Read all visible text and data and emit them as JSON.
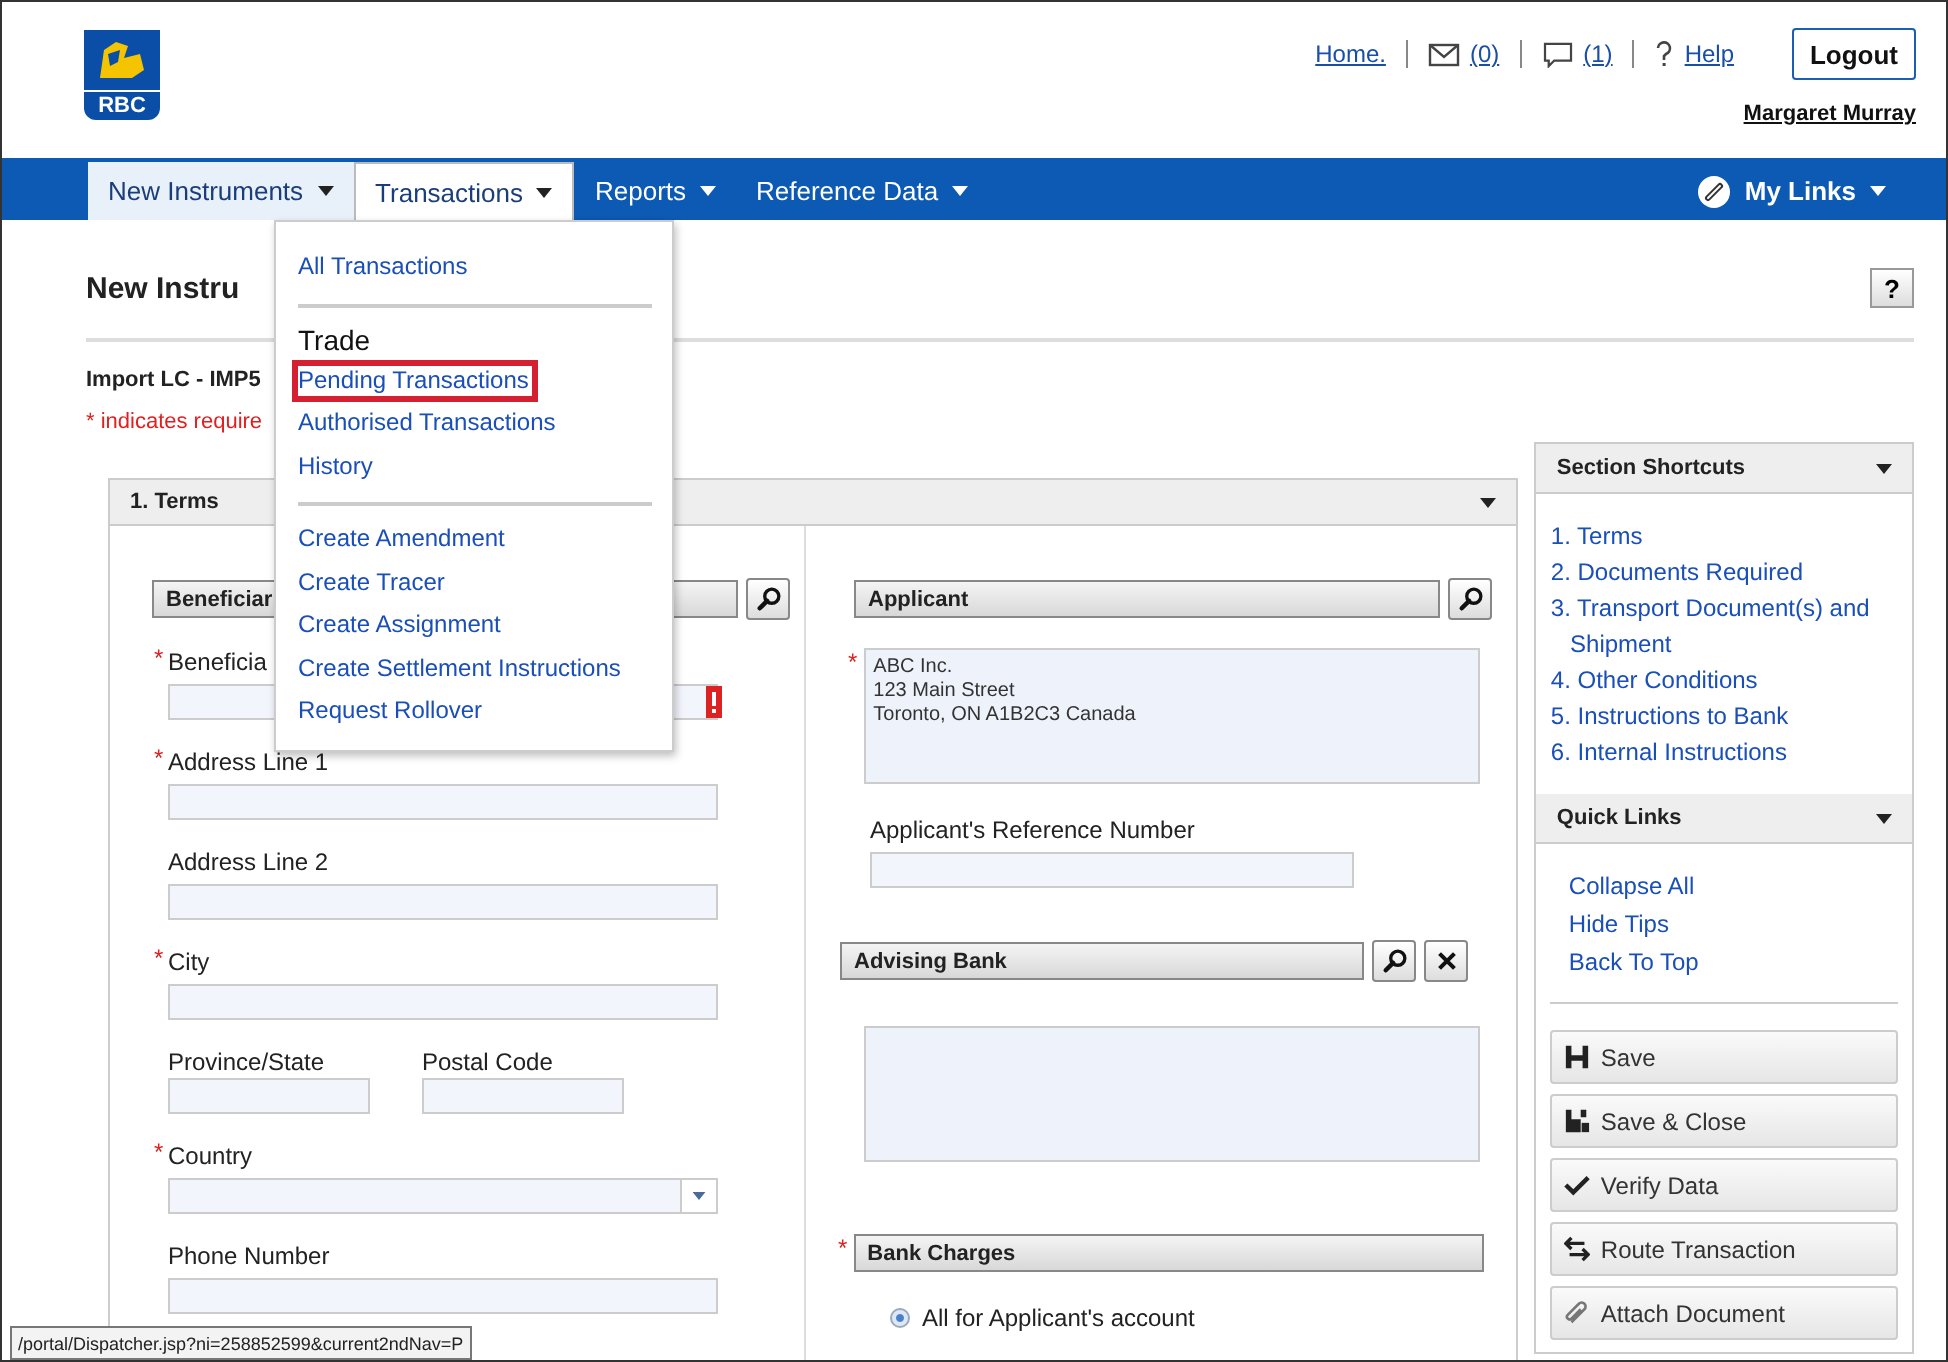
{
  "header": {
    "logo_text": "RBC",
    "links": [
      {
        "kind": "home",
        "label": "Home."
      },
      {
        "kind": "mail",
        "label": "(0)"
      },
      {
        "kind": "chat",
        "label": "(1)"
      },
      {
        "kind": "help",
        "label": "Help"
      }
    ],
    "logout": "Logout",
    "user": "Margaret Murray"
  },
  "nav": {
    "items": [
      {
        "label": "New Instruments",
        "current": true,
        "open": false
      },
      {
        "label": "Transactions",
        "current": false,
        "open": true
      },
      {
        "label": "Reports",
        "current": false,
        "open": false
      },
      {
        "label": "Reference Data",
        "current": false,
        "open": false
      }
    ],
    "my_links": "My Links"
  },
  "page": {
    "title": "New Instru",
    "help": "?",
    "subtitle": "Import LC - IMP5",
    "required_note": "* indicates require"
  },
  "terms": {
    "title": "1. Terms",
    "left": [
      {
        "kind": "lookup",
        "label": "Beneficiar",
        "clearable": false
      },
      {
        "kind": "text",
        "label": "Beneficia",
        "required": true,
        "error": true
      },
      {
        "kind": "text",
        "label": "Address Line 1",
        "required": true,
        "error": false
      },
      {
        "kind": "text",
        "label": "Address Line 2",
        "required": false,
        "error": false
      },
      {
        "kind": "text",
        "label": "City",
        "required": true,
        "error": false
      },
      {
        "kind": "pair",
        "fields": [
          {
            "label": "Province/State"
          },
          {
            "label": "Postal Code"
          }
        ]
      },
      {
        "kind": "select",
        "label": "Country",
        "required": true,
        "error": false
      },
      {
        "kind": "text",
        "label": "Phone Number",
        "required": false,
        "error": false
      }
    ],
    "right": [
      {
        "kind": "lookup",
        "label": "Applicant",
        "clearable": false
      },
      {
        "kind": "textarea",
        "required": true,
        "lines": [
          "ABC Inc.",
          "123 Main Street",
          "Toronto, ON A1B2C3 Canada"
        ]
      },
      {
        "kind": "text",
        "label": "Applicant's Reference Number",
        "required": false,
        "error": false
      },
      {
        "kind": "lookup",
        "label": "Advising Bank",
        "clearable": true
      },
      {
        "kind": "textarea",
        "required": false
      },
      {
        "kind": "bar",
        "label": "Bank Charges",
        "required": true
      },
      {
        "kind": "radio",
        "label": "All for Applicant's account",
        "selected": true
      }
    ]
  },
  "sidebar": {
    "shortcuts": {
      "title": "Section Shortcuts",
      "items": [
        "1. Terms",
        "2. Documents Required",
        "3. Transport Document(s) and Shipment",
        "4. Other Conditions",
        "5. Instructions to Bank",
        "6. Internal Instructions"
      ]
    },
    "quick_links": {
      "title": "Quick Links",
      "items": [
        "Collapse All",
        "Hide Tips",
        "Back To Top"
      ]
    },
    "actions": [
      {
        "kind": "save",
        "label": "Save"
      },
      {
        "kind": "save_close",
        "label": "Save & Close"
      },
      {
        "kind": "verify",
        "label": "Verify Data"
      },
      {
        "kind": "route",
        "label": "Route Transaction"
      },
      {
        "kind": "attach",
        "label": "Attach Document"
      }
    ]
  },
  "menu": {
    "groups": [
      {
        "items": [
          {
            "label": "All Transactions",
            "highlighted": false
          }
        ]
      },
      {
        "heading": "Trade",
        "items": [
          {
            "label": "Pending Transactions",
            "highlighted": true
          },
          {
            "label": "Authorised Transactions",
            "highlighted": false
          },
          {
            "label": "History",
            "highlighted": false
          }
        ]
      },
      {
        "items": [
          {
            "label": "Create Amendment",
            "highlighted": false
          },
          {
            "label": "Create Tracer",
            "highlighted": false
          },
          {
            "label": "Create Assignment",
            "highlighted": false
          },
          {
            "label": "Create Settlement Instructions",
            "highlighted": false
          },
          {
            "label": "Request Rollover",
            "highlighted": false
          }
        ]
      }
    ]
  },
  "required_mark": "*",
  "status_url": "/portal/Dispatcher.jsp?ni=258852599&current2ndNav=P"
}
